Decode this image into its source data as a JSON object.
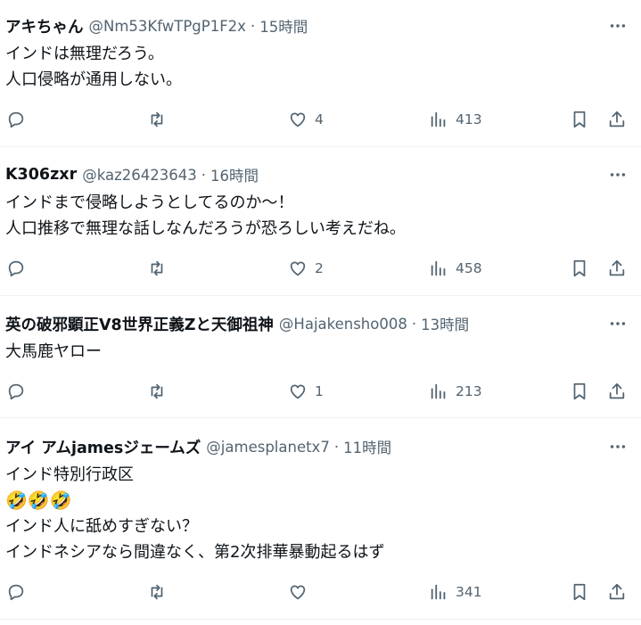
{
  "tweets": [
    {
      "name": "アキちゃん",
      "handle": "@Nm53KfwTPgP1F2x",
      "sep": "·",
      "time": "15時間",
      "lines": [
        "インドは無理だろう。",
        "人口侵略が通用しない。"
      ],
      "likes": "4",
      "views": "413"
    },
    {
      "name": "K306zxr",
      "handle": "@kaz26423643",
      "sep": "·",
      "time": "16時間",
      "lines": [
        "インドまで侵略しようとしてるのか～！",
        "人口推移で無理な話しなんだろうが恐ろしい考えだね。"
      ],
      "likes": "2",
      "views": "458"
    },
    {
      "name": "英の破邪顕正V8世界正義Zと天御祖神",
      "handle": "@Hajakensho008",
      "sep": "·",
      "time": "13時間",
      "lines": [
        "大馬鹿ヤロー"
      ],
      "likes": "1",
      "views": "213"
    },
    {
      "name": "アイ アムjamesジェームズ",
      "handle": "@jamesplanetx7",
      "sep": "·",
      "time": "11時間",
      "lines": [
        "インド特別行政区",
        "🤣🤣🤣",
        "インド人に舐めすぎない？",
        "インドネシアなら間違なく、第2次排華暴動起るはず"
      ],
      "likes": "",
      "views": "341"
    }
  ],
  "icons": {
    "more": "more-dots-icon",
    "reply": "reply-icon",
    "retweet": "retweet-icon",
    "like": "like-heart-icon",
    "views": "views-chart-icon",
    "bookmark": "bookmark-icon",
    "share": "share-icon"
  },
  "colors": {
    "text": "#0f1419",
    "secondary": "#536471",
    "divider": "#eff3f4"
  }
}
